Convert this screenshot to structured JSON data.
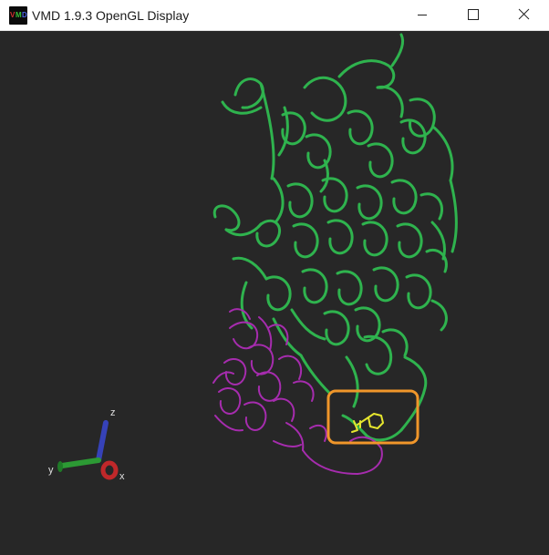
{
  "window": {
    "title": "VMD 1.9.3 OpenGL Display",
    "icon": "vmd-logo-icon",
    "icon_text": "VMD",
    "controls": [
      "minimize-icon",
      "maximize-icon",
      "close-icon"
    ]
  },
  "display": {
    "background": "#272727",
    "structure_colors": {
      "protein_chain_a": "#2fb34e",
      "protein_chain_b": "#a62cae",
      "ligand": "#e6e62e",
      "highlight_box": "#f0962a"
    },
    "axes": {
      "x": "x",
      "y": "y",
      "z": "z",
      "colors": {
        "x": "#c0282a",
        "y": "#2c9a34",
        "z": "#3642b8"
      }
    }
  }
}
